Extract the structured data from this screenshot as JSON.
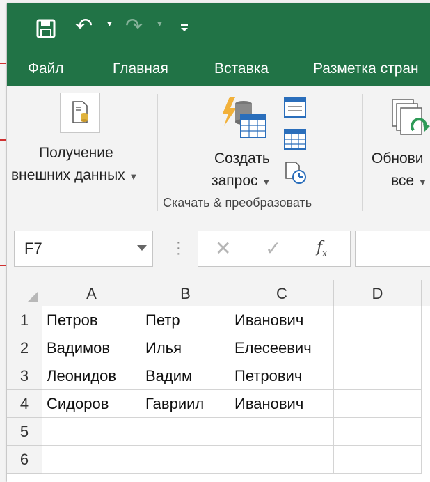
{
  "quick_access": {
    "save": "save-icon",
    "undo": "undo-icon",
    "redo": "redo-icon",
    "customize": "customize-icon"
  },
  "tabs": [
    "Файл",
    "Главная",
    "Вставка",
    "Разметка стран"
  ],
  "ribbon": {
    "get_data": {
      "line1": "Получение",
      "line2": "внешних данных",
      "icon": "database-file-icon"
    },
    "new_query": {
      "line1": "Создать",
      "line2": "запрос",
      "icon": "query-table-icon"
    },
    "small_icons": [
      "show-queries-icon",
      "from-table-icon",
      "recent-sources-icon"
    ],
    "refresh": {
      "line1": "Обнови",
      "line2": "все",
      "icon": "refresh-all-icon"
    },
    "group_label": "Скачать & преобразовать"
  },
  "formula_bar": {
    "name_box": "F7",
    "cancel": "✕",
    "enter": "✓",
    "fx": "fx",
    "formula": ""
  },
  "sheet": {
    "columns": [
      "A",
      "B",
      "C",
      "D"
    ],
    "rows": [
      {
        "num": "1",
        "cells": [
          "Петров",
          "Петр",
          "Иванович",
          ""
        ]
      },
      {
        "num": "2",
        "cells": [
          "Вадимов",
          "Илья",
          "Елесеевич",
          ""
        ]
      },
      {
        "num": "3",
        "cells": [
          "Леонидов",
          "Вадим",
          "Петрович",
          ""
        ]
      },
      {
        "num": "4",
        "cells": [
          "Сидоров",
          "Гавриил",
          "Иванович",
          ""
        ]
      },
      {
        "num": "5",
        "cells": [
          "",
          "",
          "",
          ""
        ]
      },
      {
        "num": "6",
        "cells": [
          "",
          "",
          "",
          ""
        ]
      }
    ]
  },
  "colors": {
    "title_green": "#217346",
    "ribbon_bg": "#f3f3f3",
    "grid_line": "#d4d4d4"
  }
}
